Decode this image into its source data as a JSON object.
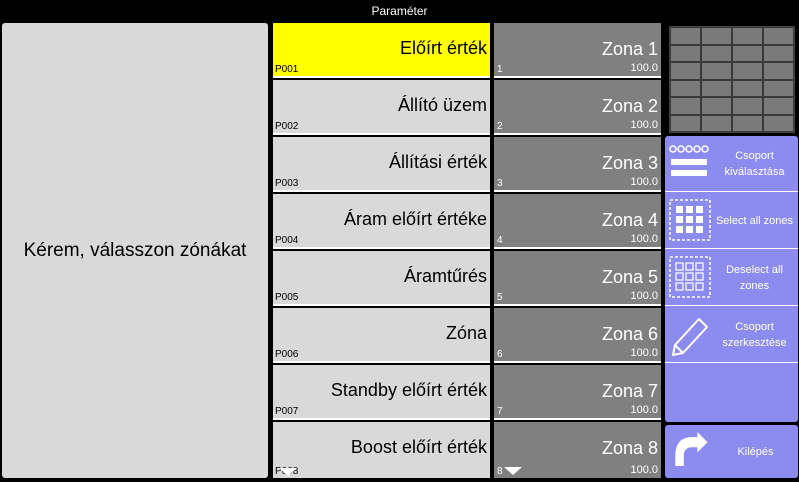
{
  "window": {
    "title": "Paraméter"
  },
  "left": {
    "prompt": "Kérem, válasszon zónákat"
  },
  "params": [
    {
      "name": "Előírt érték",
      "code": "P001"
    },
    {
      "name": "Állító üzem",
      "code": "P002"
    },
    {
      "name": "Állítási érték",
      "code": "P003"
    },
    {
      "name": "Áram előírt értéke",
      "code": "P004"
    },
    {
      "name": "Áramtűrés",
      "code": "P005"
    },
    {
      "name": "Zóna",
      "code": "P006"
    },
    {
      "name": "Standby előírt érték",
      "code": "P007"
    },
    {
      "name": "Boost előírt érték",
      "code": "P008"
    }
  ],
  "zones": [
    {
      "name": "Zona 1",
      "value": "100.0",
      "num": "1"
    },
    {
      "name": "Zona 2",
      "value": "100.0",
      "num": "2"
    },
    {
      "name": "Zona 3",
      "value": "100.0",
      "num": "3"
    },
    {
      "name": "Zona 4",
      "value": "100.0",
      "num": "4"
    },
    {
      "name": "Zona 5",
      "value": "100.0",
      "num": "5"
    },
    {
      "name": "Zona 6",
      "value": "100.0",
      "num": "6"
    },
    {
      "name": "Zona 7",
      "value": "100.0",
      "num": "7"
    },
    {
      "name": "Zona 8",
      "value": "100.0",
      "num": "8"
    }
  ],
  "actions": {
    "group_select": "Csoport kiválasztása",
    "select_all": "Select all zones",
    "deselect_all": "Deselect all zones",
    "group_edit": "Csoport szerkesztése",
    "exit": "Kilépés"
  },
  "colors": {
    "selected": "#ffff00",
    "panel": "#d9d9d9",
    "zone": "#808080",
    "action": "#8c8cf0"
  }
}
